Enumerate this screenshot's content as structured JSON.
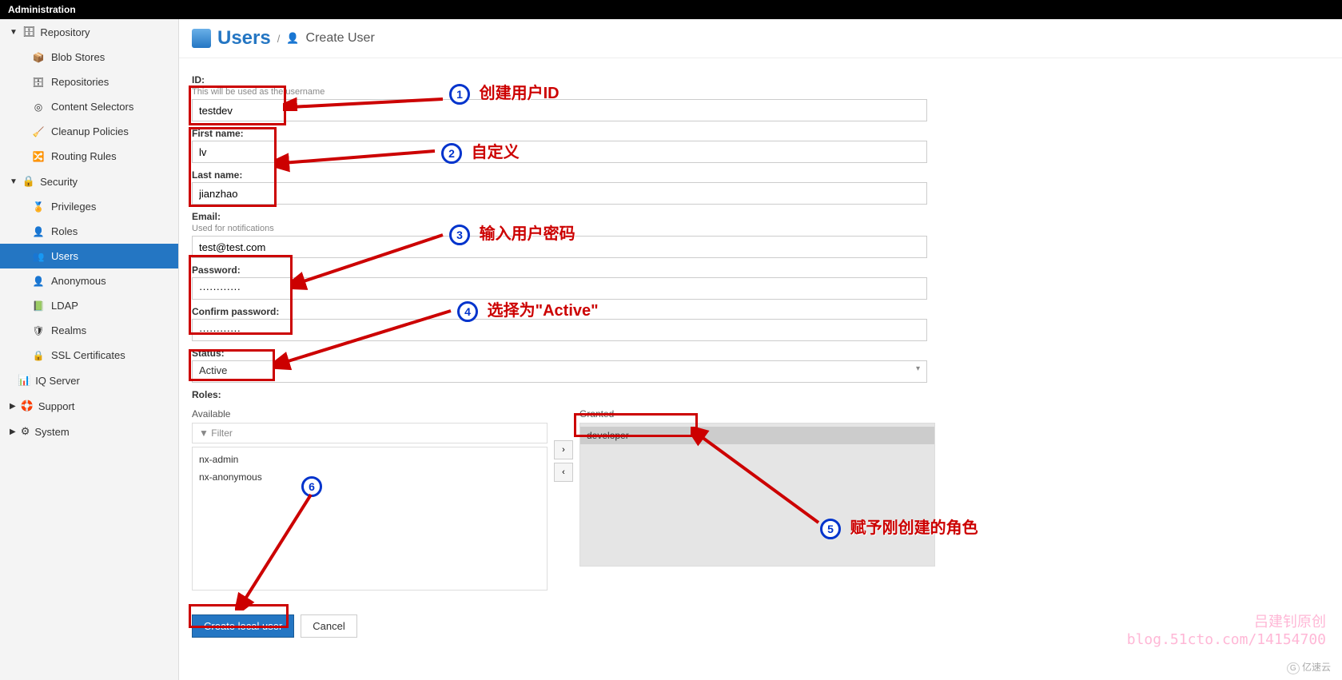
{
  "topbar": {
    "title": "Administration"
  },
  "sidebar": {
    "repository": {
      "label": "Repository",
      "items": [
        {
          "label": "Blob Stores",
          "icon": "📦"
        },
        {
          "label": "Repositories",
          "icon": "🗄"
        },
        {
          "label": "Content Selectors",
          "icon": "◎"
        },
        {
          "label": "Cleanup Policies",
          "icon": "🧹"
        },
        {
          "label": "Routing Rules",
          "icon": "🔀"
        }
      ]
    },
    "security": {
      "label": "Security",
      "items": [
        {
          "label": "Privileges",
          "icon": "🏅"
        },
        {
          "label": "Roles",
          "icon": "👤"
        },
        {
          "label": "Users",
          "icon": "👥",
          "active": true
        },
        {
          "label": "Anonymous",
          "icon": "👤"
        },
        {
          "label": "LDAP",
          "icon": "📗"
        },
        {
          "label": "Realms",
          "icon": "🛡"
        },
        {
          "label": "SSL Certificates",
          "icon": "🔒"
        }
      ]
    },
    "other": [
      {
        "label": "IQ Server",
        "icon": "📊"
      },
      {
        "label": "Support",
        "icon": "🛟",
        "caret": true
      },
      {
        "label": "System",
        "icon": "⚙",
        "caret": true
      }
    ]
  },
  "header": {
    "title": "Users",
    "breadcrumb": "Create User"
  },
  "form": {
    "id": {
      "label": "ID:",
      "help": "This will be used as the username",
      "value": "testdev"
    },
    "first": {
      "label": "First name:",
      "value": "lv"
    },
    "last": {
      "label": "Last name:",
      "value": "jianzhao"
    },
    "email": {
      "label": "Email:",
      "help": "Used for notifications",
      "value": "test@test.com"
    },
    "password": {
      "label": "Password:",
      "value": "············"
    },
    "confirm": {
      "label": "Confirm password:",
      "value": "············"
    },
    "status": {
      "label": "Status:",
      "value": "Active"
    },
    "roles": {
      "label": "Roles:",
      "available_label": "Available",
      "granted_label": "Granted",
      "filter_placeholder": "Filter",
      "available": [
        "nx-admin",
        "nx-anonymous"
      ],
      "granted": [
        "developer"
      ]
    }
  },
  "actions": {
    "create": "Create local user",
    "cancel": "Cancel"
  },
  "annotations": {
    "a1": {
      "num": "1",
      "text": "创建用户ID"
    },
    "a2": {
      "num": "2",
      "text": "自定义"
    },
    "a3": {
      "num": "3",
      "text": "输入用户密码"
    },
    "a4": {
      "num": "4",
      "text": "选择为\"Active\""
    },
    "a5": {
      "num": "5",
      "text": "赋予刚创建的角色"
    },
    "a6": {
      "num": "6",
      "text": ""
    }
  },
  "watermark": {
    "line1": "吕建钊原创",
    "line2": "blog.51cto.com/14154700"
  },
  "brand": "亿速云"
}
